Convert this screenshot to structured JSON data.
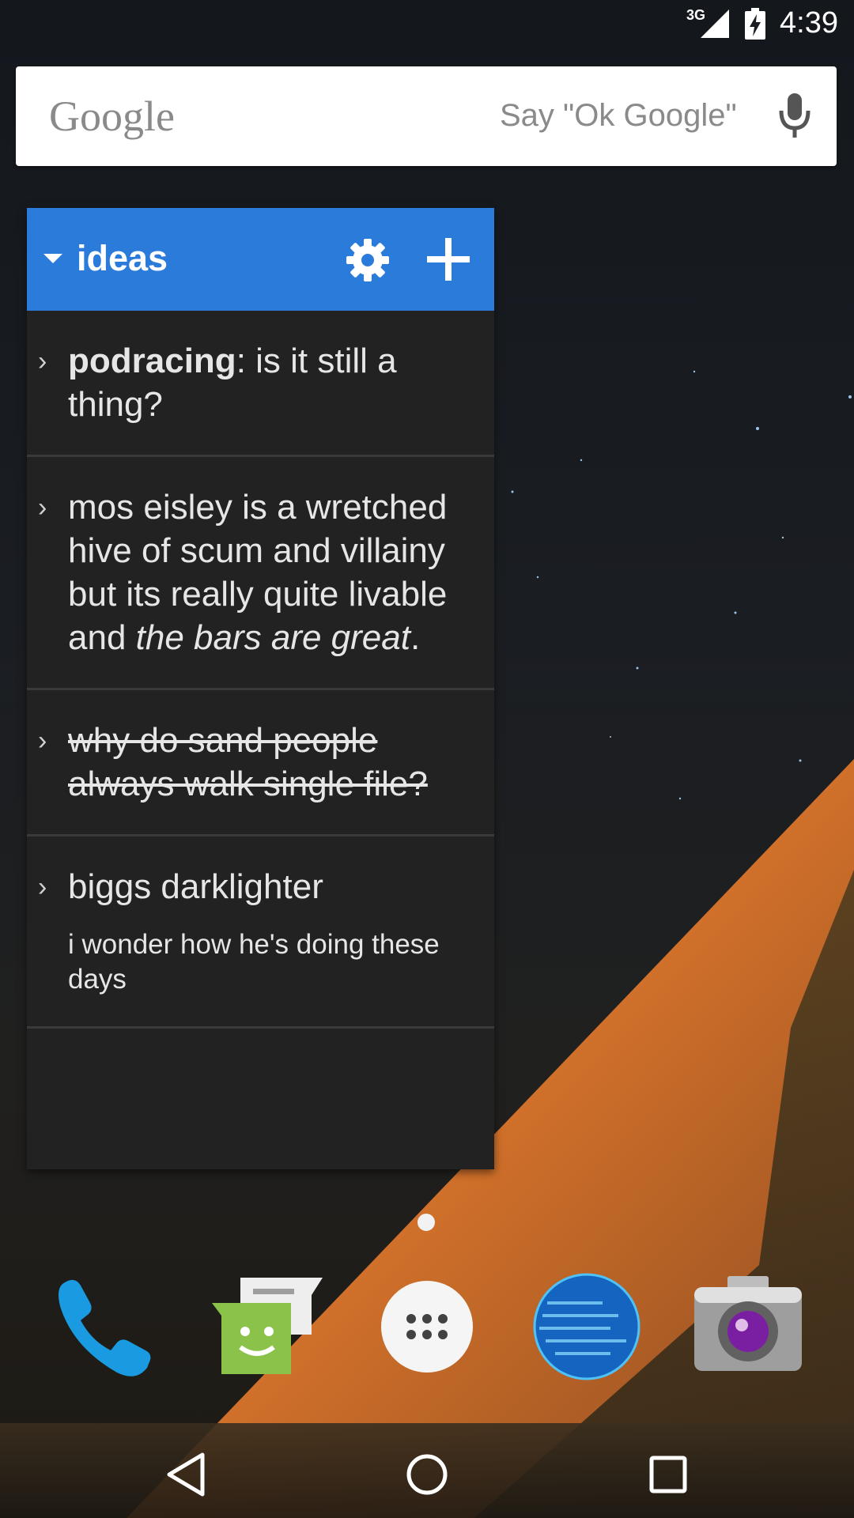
{
  "status_bar": {
    "network_type": "3G",
    "time": "4:39"
  },
  "search_bar": {
    "logo": "Google",
    "hint": "Say \"Ok Google\"",
    "mic_icon": "microphone-icon"
  },
  "widget": {
    "title": "ideas",
    "header_color": "#2b7bdb",
    "items": [
      {
        "bold_part": "podracing",
        "rest": ": is it still a thing?"
      },
      {
        "plain_part": "mos eisley is a wretched hive of scum and villainy but its really quite livable and ",
        "italic_part": "the bars are great",
        "end": "."
      },
      {
        "strike_text": "why do sand people always walk single file?"
      },
      {
        "title": "biggs darklighter",
        "note": "i wonder how he's doing these days"
      }
    ]
  },
  "dock": [
    {
      "name": "phone",
      "icon": "phone-icon"
    },
    {
      "name": "messaging",
      "icon": "messaging-icon"
    },
    {
      "name": "app-drawer",
      "icon": "app-drawer-icon"
    },
    {
      "name": "browser",
      "icon": "globe-icon"
    },
    {
      "name": "camera",
      "icon": "camera-icon"
    }
  ],
  "nav": [
    "back-icon",
    "home-icon",
    "recents-icon"
  ]
}
